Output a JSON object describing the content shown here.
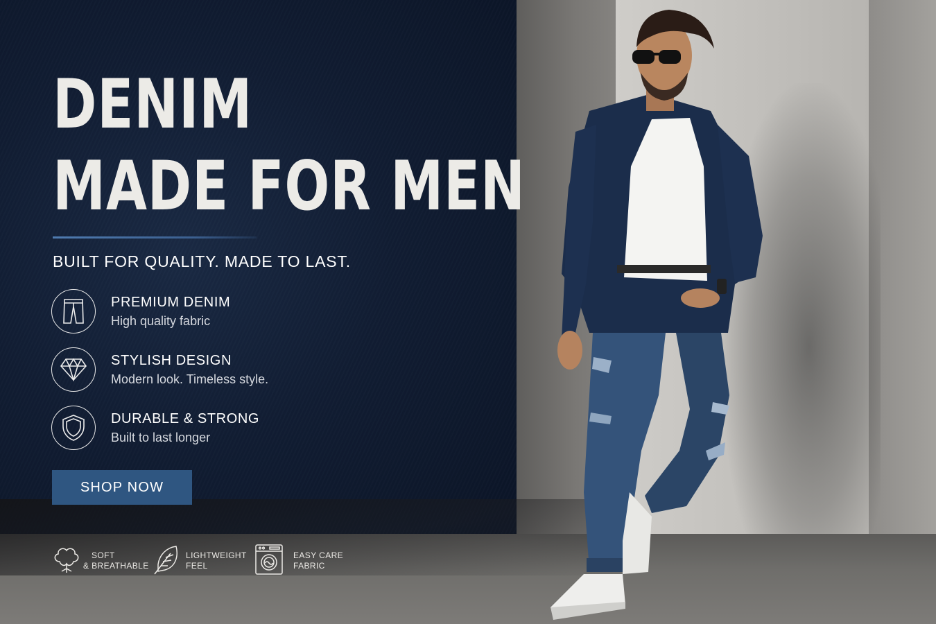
{
  "hero": {
    "headline_line1": "DENIM",
    "headline_line2": "MADE FOR MEN",
    "tagline": "BUILT FOR QUALITY. MADE TO LAST."
  },
  "features": [
    {
      "icon": "jeans-icon",
      "title": "PREMIUM DENIM",
      "subtitle": "High quality fabric"
    },
    {
      "icon": "diamond-icon",
      "title": "STYLISH DESIGN",
      "subtitle": "Modern look. Timeless style."
    },
    {
      "icon": "shield-icon",
      "title": "DURABLE & STRONG",
      "subtitle": "Built to last longer"
    }
  ],
  "cta": {
    "label": "SHOP NOW"
  },
  "badges": [
    {
      "icon": "cotton-icon",
      "line1": "SOFT",
      "line2": "& BREATHABLE"
    },
    {
      "icon": "feather-icon",
      "line1": "LIGHTWEIGHT",
      "line2": "FEEL"
    },
    {
      "icon": "washing-machine-icon",
      "line1": "EASY CARE",
      "line2": "FABRIC"
    }
  ],
  "colors": {
    "navy_background": "#111d33",
    "accent_blue": "#2f5681",
    "text_light": "#ecebe7"
  }
}
